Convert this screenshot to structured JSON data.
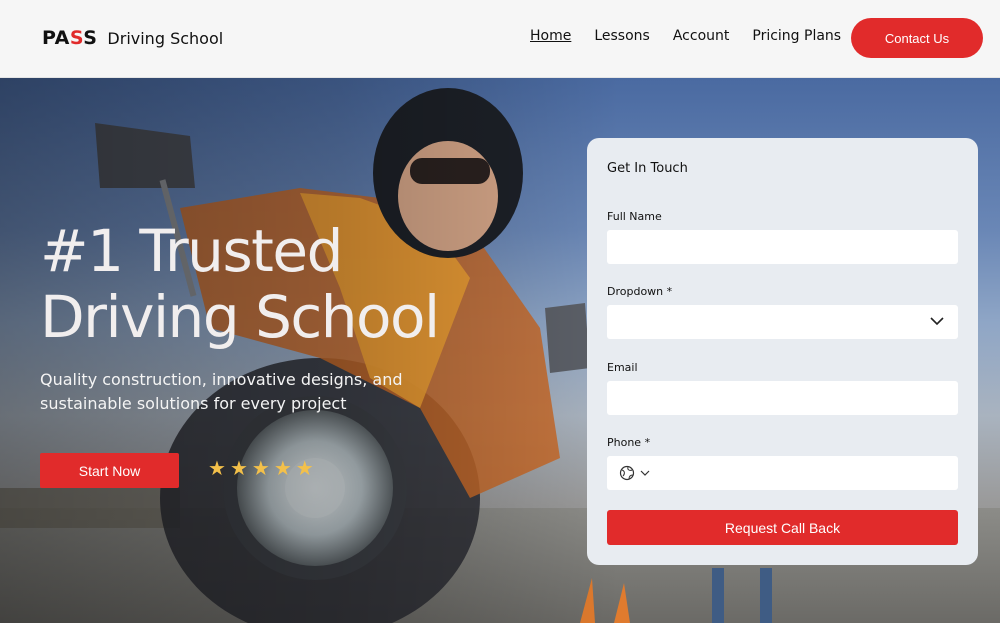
{
  "brand": {
    "mark_main": "PA",
    "mark_accent": "S",
    "mark_end": "S",
    "name": "Driving School"
  },
  "nav": {
    "items": [
      {
        "label": "Home",
        "active": true
      },
      {
        "label": "Lessons",
        "active": false
      },
      {
        "label": "Account",
        "active": false
      },
      {
        "label": "Pricing Plans",
        "active": false
      }
    ],
    "contact_label": "Contact Us"
  },
  "hero": {
    "title_line1": "#1 Trusted",
    "title_line2": "Driving School",
    "subtitle": "Quality construction, innovative designs, and sustainable solutions for every project",
    "cta_label": "Start Now",
    "rating_stars": 5
  },
  "form": {
    "title": "Get In Touch",
    "full_name_label": "Full Name",
    "full_name_value": "",
    "dropdown_label": "Dropdown *",
    "dropdown_value": "",
    "email_label": "Email",
    "email_value": "",
    "phone_label": "Phone *",
    "phone_value": "",
    "submit_label": "Request Call Back"
  },
  "colors": {
    "accent": "#e12b2b",
    "star": "#f3c04a",
    "card": "#e8ecf1",
    "header": "#f6f6f6"
  },
  "icons": [
    "chevron-down-icon",
    "globe-icon",
    "star-icon"
  ]
}
